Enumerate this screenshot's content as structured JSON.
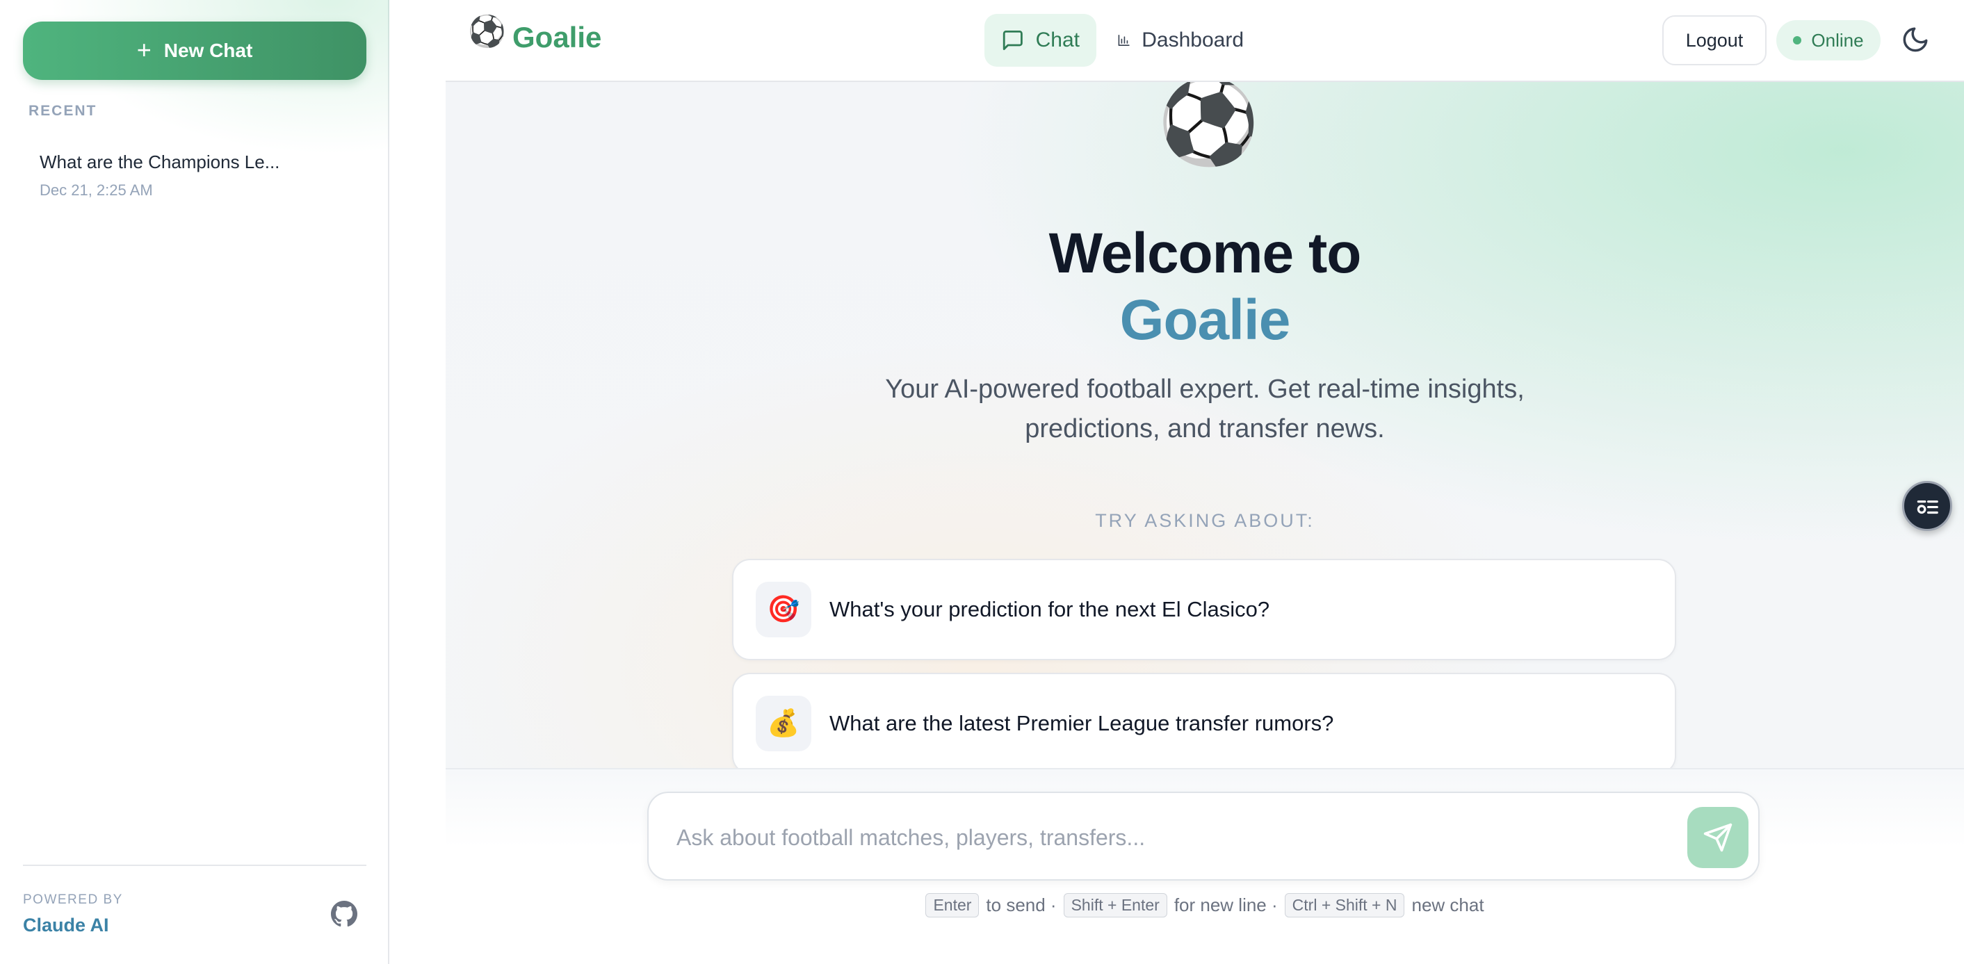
{
  "sidebar": {
    "new_chat_label": "New Chat",
    "recent_label": "RECENT",
    "recent_items": [
      {
        "title": "What are the Champions Le...",
        "date": "Dec 21, 2:25 AM"
      }
    ],
    "powered_by_label": "POWERED BY",
    "powered_by_link": "Claude AI",
    "github_icon": "github-icon"
  },
  "header": {
    "brand_icon": "⚽",
    "brand_name": "Goalie",
    "tabs": [
      {
        "label": "Chat",
        "icon": "chat-bubble-icon",
        "active": true
      },
      {
        "label": "Dashboard",
        "icon": "bar-chart-icon",
        "active": false
      }
    ],
    "logout_label": "Logout",
    "status_label": "Online",
    "theme_icon": "moon-icon"
  },
  "main": {
    "hero_icon": "⚽",
    "welcome_line1": "Welcome to",
    "welcome_line2": "Goalie",
    "subtitle": "Your AI-powered football expert. Get real-time insights, predictions, and transfer news.",
    "try_label": "TRY ASKING ABOUT:",
    "suggestions": [
      {
        "icon": "🎯",
        "text": "What's your prediction for the next El Clasico?"
      },
      {
        "icon": "💰",
        "text": "What are the latest Premier League transfer rumors?"
      }
    ]
  },
  "input": {
    "placeholder": "Ask about football matches, players, transfers...",
    "value": "",
    "hints": {
      "key1": "Enter",
      "text1": "to send ·",
      "key2": "Shift + Enter",
      "text2": "for new line ·",
      "key3": "Ctrl + Shift + N",
      "text3": "new chat"
    }
  },
  "colors": {
    "brand_green": "#3f9d6b",
    "accent_blue": "#4a8fb0",
    "send_button": "#a7dcbf"
  }
}
